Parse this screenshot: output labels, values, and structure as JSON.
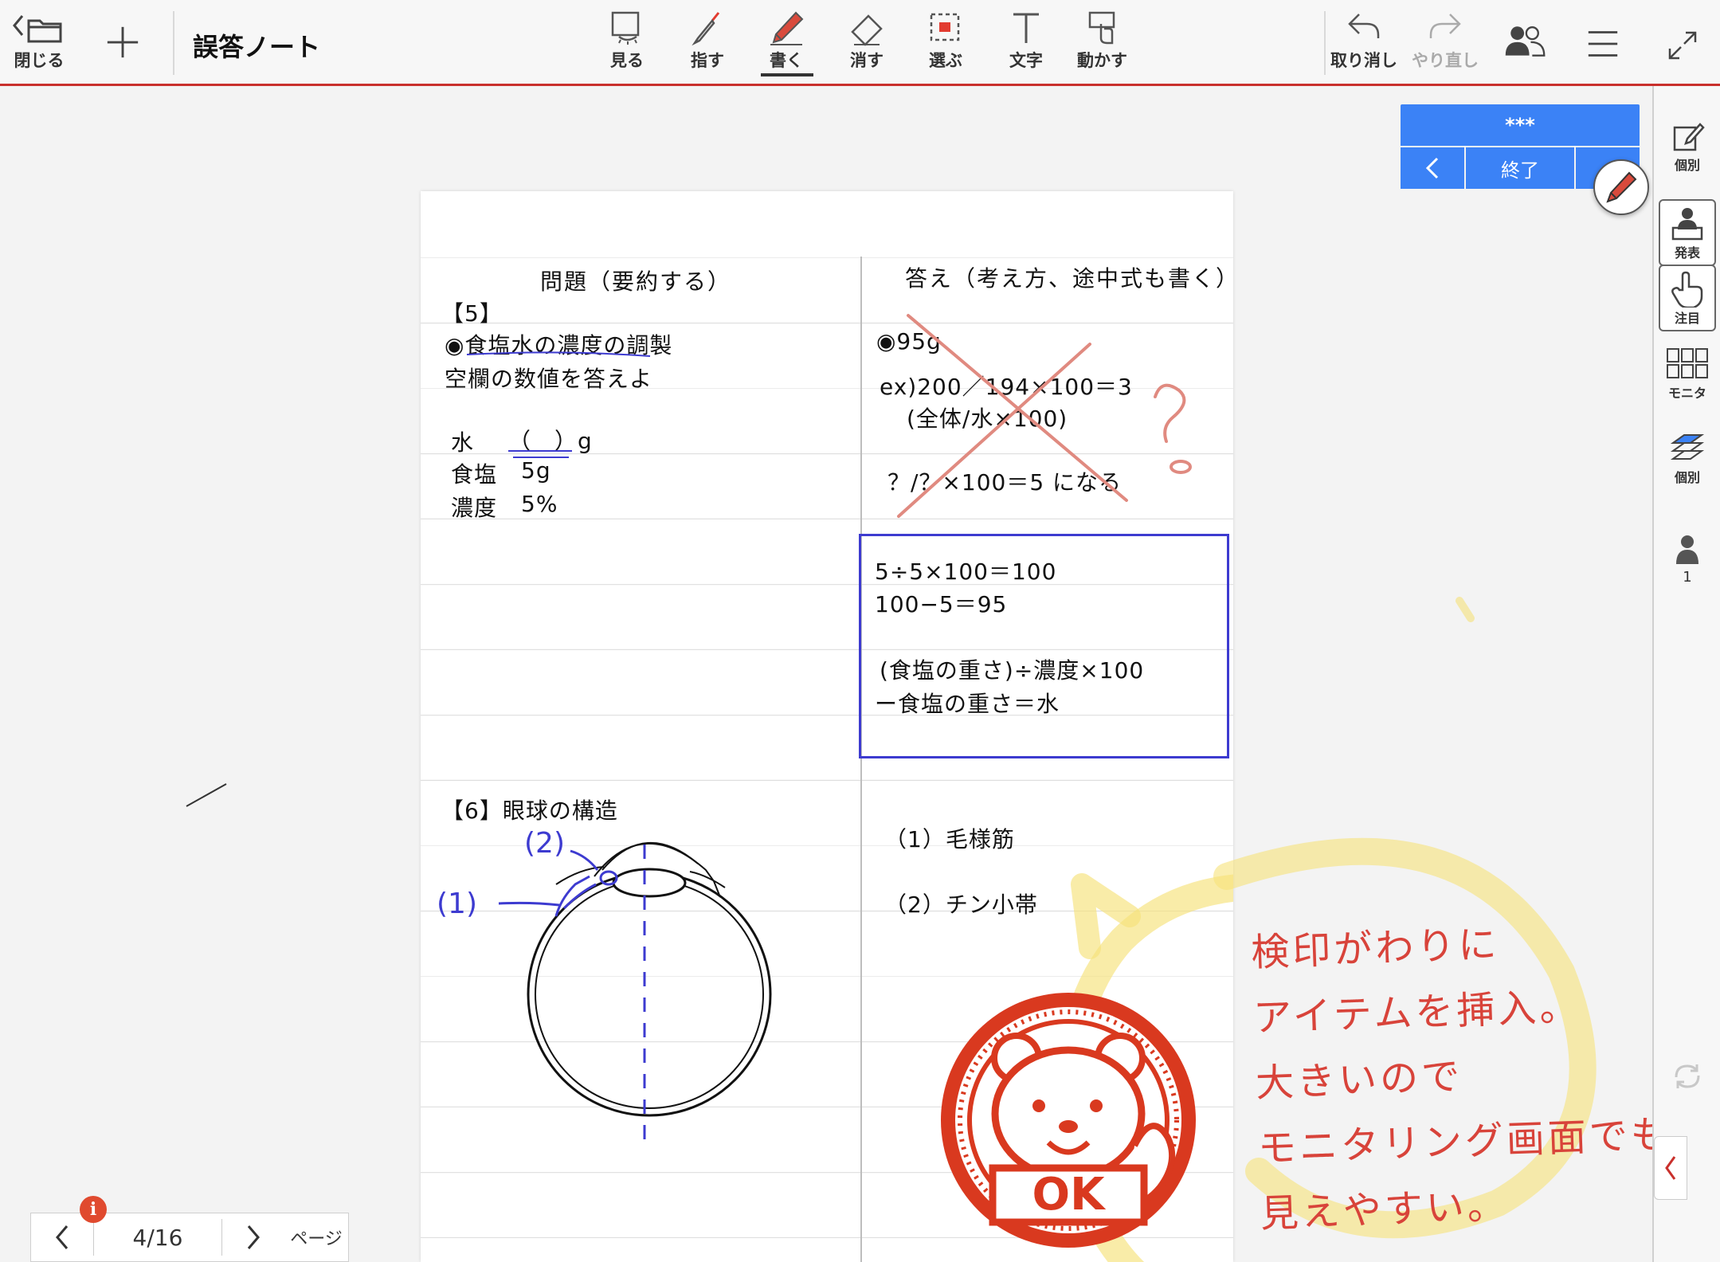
{
  "toolbar": {
    "close_label": "閉じる",
    "title": "誤答ノート",
    "tools": [
      {
        "label": "見る",
        "icon": "view-icon"
      },
      {
        "label": "指す",
        "icon": "laser-pointer-icon"
      },
      {
        "label": "書く",
        "icon": "pen-icon",
        "active": true
      },
      {
        "label": "消す",
        "icon": "eraser-icon"
      },
      {
        "label": "選ぶ",
        "icon": "select-icon"
      },
      {
        "label": "文字",
        "icon": "text-icon"
      },
      {
        "label": "動かす",
        "icon": "move-icon"
      }
    ],
    "undo_label": "取り消し",
    "redo_label": "やり直し"
  },
  "session": {
    "name": "***",
    "end_label": "終了"
  },
  "sidebar": {
    "items": [
      {
        "label": "個別",
        "icon": "individual-edit-icon"
      },
      {
        "label": "発表",
        "icon": "presentation-icon"
      },
      {
        "label": "注目",
        "icon": "attention-hand-icon"
      },
      {
        "label": "モニタ",
        "icon": "monitor-grid-icon"
      },
      {
        "label": "個別",
        "icon": "individual-layers-icon"
      },
      {
        "label": "1",
        "icon": "user-count-icon"
      }
    ]
  },
  "pager": {
    "page": "4/16",
    "label": "ページ",
    "badge": "i"
  },
  "note": {
    "left_header": "問題（要約する）",
    "right_header": "答え（考え方、途中式も書く）",
    "q5": {
      "number": "【5】",
      "title": "◉食塩水の濃度の調製",
      "instruction": "空欄の数値を答えよ",
      "rows": [
        {
          "label": "水",
          "value": "（　）g"
        },
        {
          "label": "食塩",
          "value": "5g"
        },
        {
          "label": "濃度",
          "value": "5%"
        }
      ]
    },
    "wrong_answer": {
      "lines": [
        "◉95g",
        "ex)200／194×100＝3",
        "(全体/水×100)",
        "？/？×100＝5 になる"
      ],
      "question_mark": "?"
    },
    "corrected": {
      "lines": [
        "5÷5×100＝100",
        "100−5＝95",
        "(食塩の重さ)÷濃度×100",
        "ー食塩の重さ＝水"
      ]
    },
    "q6": {
      "title": "【6】眼球の構造",
      "label1": "(1)",
      "label2": "(2)"
    },
    "answers6": [
      "（1）毛様筋",
      "（2）チン小帯"
    ],
    "stamp_text": "OK",
    "handwritten": [
      "検印がわりに",
      "アイテムを挿入。",
      "大きいので",
      "モニタリング画面でも",
      "見えやすい。"
    ]
  },
  "colors": {
    "accent_red": "#c9302c",
    "session_blue": "#3b82f6",
    "ink_blue": "#3d3bd0",
    "stamp_red": "#d9391f",
    "annotation_red": "#d8433a",
    "highlight_yellow": "#f6e27a"
  }
}
